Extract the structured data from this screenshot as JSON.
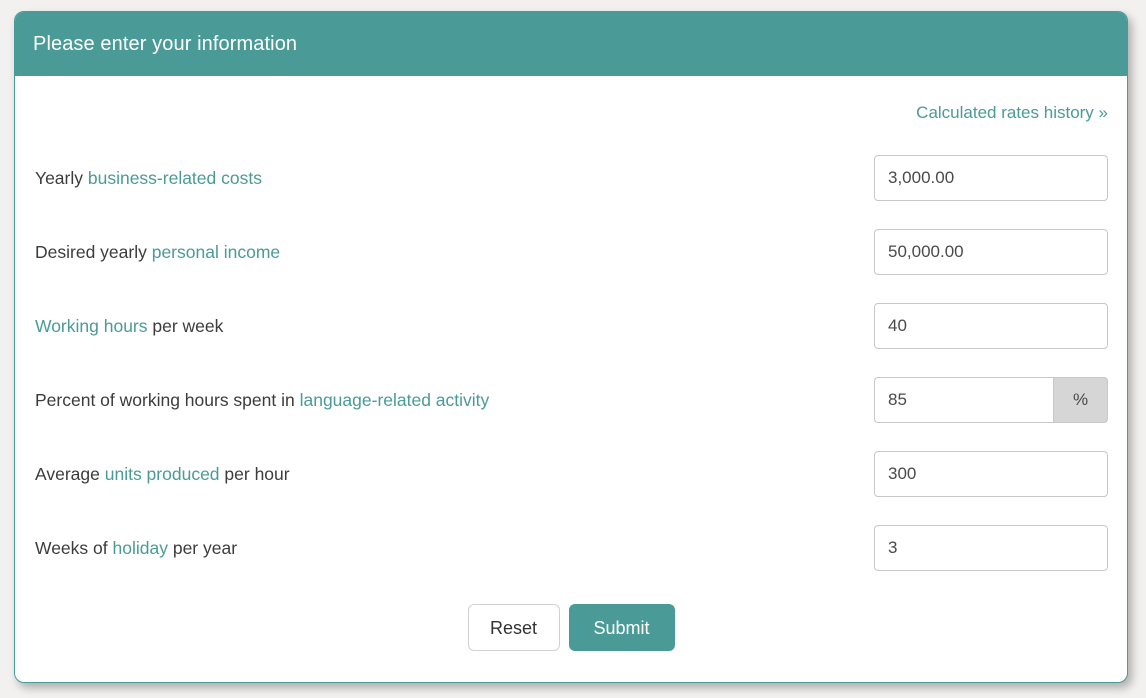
{
  "header": {
    "title": "Please enter your information"
  },
  "colors": {
    "accent": "#4a9b98",
    "page_background": "#f2f1ef",
    "label_text": "#3c3c3c",
    "input_border": "#c8c8c8",
    "addon_background": "#d6d6d6"
  },
  "history": {
    "link_label": "Calculated rates history »"
  },
  "form": {
    "rows": [
      {
        "label_prefix": "Yearly ",
        "label_link": "business-related costs",
        "label_suffix": "",
        "value": "3,000.00",
        "placeholder": "",
        "addon": null
      },
      {
        "label_prefix": "Desired yearly ",
        "label_link": "personal income",
        "label_suffix": "",
        "value": "50,000.00",
        "placeholder": "",
        "addon": null
      },
      {
        "label_prefix": "",
        "label_link": "Working hours",
        "label_suffix": " per week",
        "value": "40",
        "placeholder": "",
        "addon": null
      },
      {
        "label_prefix": "Percent of working hours spent in ",
        "label_link": "language-related activity",
        "label_suffix": "",
        "value": "85",
        "placeholder": "",
        "addon": "%"
      },
      {
        "label_prefix": "Average ",
        "label_link": "units produced",
        "label_suffix": " per hour",
        "value": "300",
        "placeholder": "",
        "addon": null
      },
      {
        "label_prefix": "Weeks of ",
        "label_link": "holiday",
        "label_suffix": " per year",
        "value": "3",
        "placeholder": "",
        "addon": null
      }
    ]
  },
  "actions": {
    "reset_label": "Reset",
    "submit_label": "Submit"
  }
}
